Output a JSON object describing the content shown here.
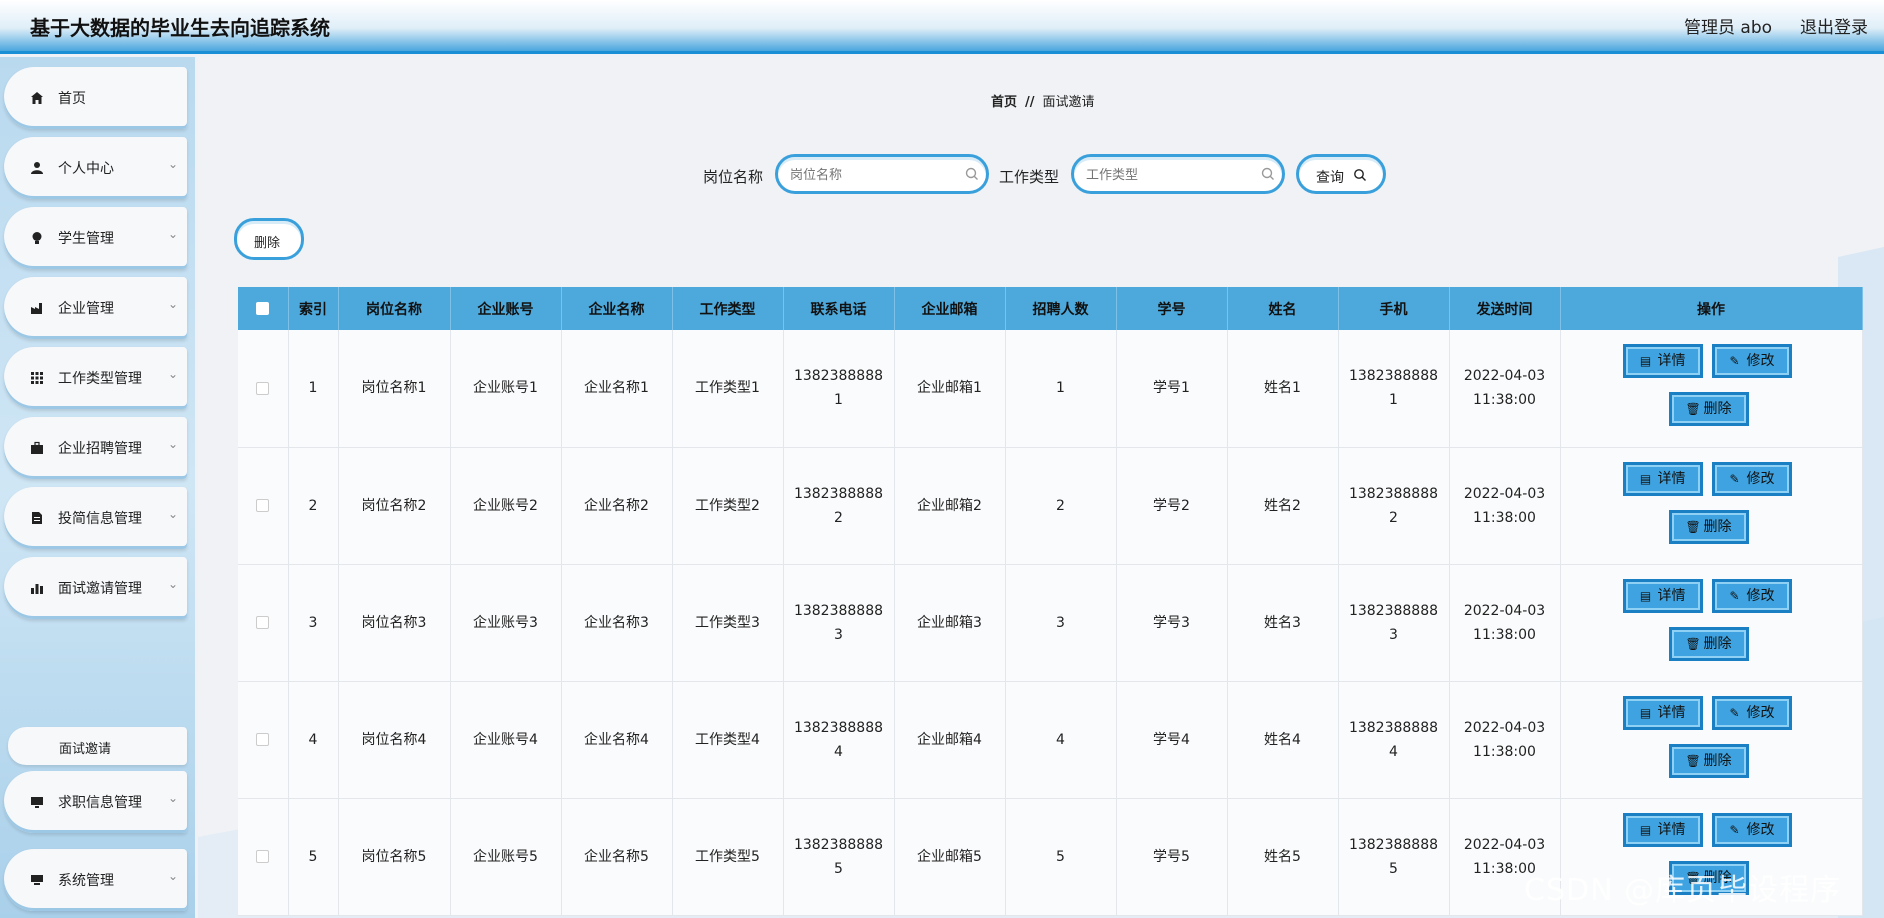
{
  "header": {
    "title": "基于大数据的毕业生去向追踪系统",
    "admin": "管理员 abo",
    "logout": "退出登录"
  },
  "sidebar": {
    "items": [
      {
        "label": "首页",
        "icon": "home-icon"
      },
      {
        "label": "个人中心",
        "icon": "user-icon"
      },
      {
        "label": "学生管理",
        "icon": "bulb-icon"
      },
      {
        "label": "企业管理",
        "icon": "factory-icon"
      },
      {
        "label": "工作类型管理",
        "icon": "grid-icon"
      },
      {
        "label": "企业招聘管理",
        "icon": "briefcase-icon"
      },
      {
        "label": "投简信息管理",
        "icon": "document-icon"
      },
      {
        "label": "面试邀请管理",
        "icon": "bar-chart-icon"
      },
      {
        "label": "求职信息管理",
        "icon": "monitor-icon"
      },
      {
        "label": "系统管理",
        "icon": "desktop-icon"
      }
    ],
    "submenu": "面试邀请"
  },
  "breadcrumb": {
    "home": "首页",
    "separator": "//",
    "current": "面试邀请"
  },
  "search": {
    "job_label": "岗位名称",
    "job_placeholder": "岗位名称",
    "type_label": "工作类型",
    "type_placeholder": "工作类型",
    "query_label": "查询"
  },
  "toolbar": {
    "delete_label": "删除"
  },
  "table": {
    "headers": [
      "索引",
      "岗位名称",
      "企业账号",
      "企业名称",
      "工作类型",
      "联系电话",
      "企业邮箱",
      "招聘人数",
      "学号",
      "姓名",
      "手机",
      "发送时间",
      "操作"
    ],
    "rows": [
      {
        "index": "1",
        "job": "岗位名称1",
        "account": "企业账号1",
        "company": "企业名称1",
        "type": "工作类型1",
        "phone": "13823888881",
        "email": "企业邮箱1",
        "count": "1",
        "student_no": "学号1",
        "name": "姓名1",
        "mobile": "13823888881",
        "sent": "2022-04-03 11:38:00"
      },
      {
        "index": "2",
        "job": "岗位名称2",
        "account": "企业账号2",
        "company": "企业名称2",
        "type": "工作类型2",
        "phone": "13823888882",
        "email": "企业邮箱2",
        "count": "2",
        "student_no": "学号2",
        "name": "姓名2",
        "mobile": "13823888882",
        "sent": "2022-04-03 11:38:00"
      },
      {
        "index": "3",
        "job": "岗位名称3",
        "account": "企业账号3",
        "company": "企业名称3",
        "type": "工作类型3",
        "phone": "13823888883",
        "email": "企业邮箱3",
        "count": "3",
        "student_no": "学号3",
        "name": "姓名3",
        "mobile": "13823888883",
        "sent": "2022-04-03 11:38:00"
      },
      {
        "index": "4",
        "job": "岗位名称4",
        "account": "企业账号4",
        "company": "企业名称4",
        "type": "工作类型4",
        "phone": "13823888884",
        "email": "企业邮箱4",
        "count": "4",
        "student_no": "学号4",
        "name": "姓名4",
        "mobile": "13823888884",
        "sent": "2022-04-03 11:38:00"
      },
      {
        "index": "5",
        "job": "岗位名称5",
        "account": "企业账号5",
        "company": "企业名称5",
        "type": "工作类型5",
        "phone": "13823888885",
        "email": "企业邮箱5",
        "count": "5",
        "student_no": "学号5",
        "name": "姓名5",
        "mobile": "13823888885",
        "sent": "2022-04-03 11:38:00"
      }
    ],
    "actions": {
      "detail": "详情",
      "edit": "修改",
      "delete": "删除"
    }
  },
  "watermark": "CSDN @库页毕设程序",
  "colors": {
    "accent": "#3aa0dc",
    "header_blue": "#4da9dc",
    "button_blue": "#3ea3e0"
  }
}
